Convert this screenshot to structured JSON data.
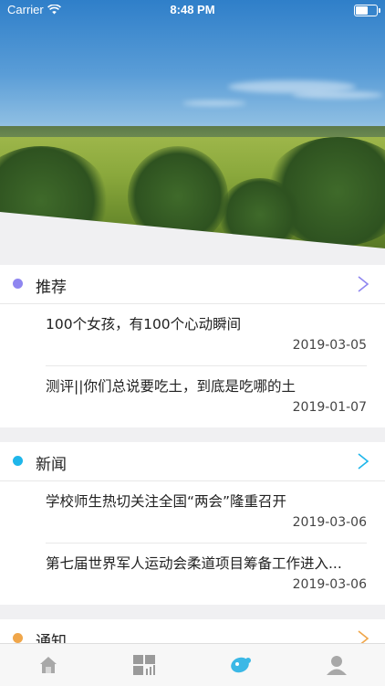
{
  "status_bar": {
    "carrier": "Carrier",
    "time": "8:48 PM"
  },
  "sections": [
    {
      "title": "推荐",
      "dot_color": "#8f86f0",
      "items": [
        {
          "title": "100个女孩，有100个心动瞬间",
          "date": "2019-03-05"
        },
        {
          "title": "测评||你们总说要吃土，到底是吃哪的土",
          "date": "2019-01-07"
        }
      ]
    },
    {
      "title": "新闻",
      "dot_color": "#1fb6ea",
      "items": [
        {
          "title": "学校师生热切关注全国“两会”隆重召开",
          "date": "2019-03-06"
        },
        {
          "title": "第七届世界军人运动会柔道项目筹备工作进入...",
          "date": "2019-03-06"
        }
      ]
    },
    {
      "title": "通知",
      "dot_color": "#f0a64a"
    }
  ],
  "tabbar": {
    "tabs": [
      {
        "icon": "home-icon",
        "active": false
      },
      {
        "icon": "grid-chart-icon",
        "active": false
      },
      {
        "icon": "discover-icon",
        "active": true
      },
      {
        "icon": "profile-icon",
        "active": false
      }
    ],
    "active_color": "#3bb8e6",
    "inactive_color": "#9a9a9a"
  }
}
